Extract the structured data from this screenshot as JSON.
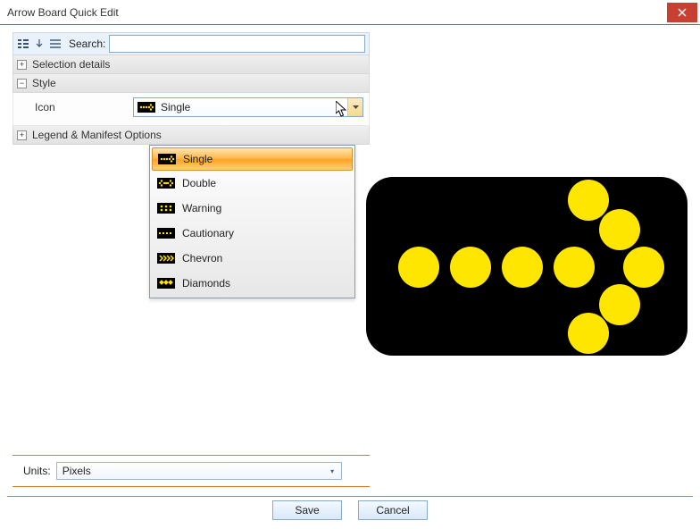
{
  "window": {
    "title": "Arrow Board Quick Edit"
  },
  "search": {
    "label": "Search:",
    "value": ""
  },
  "sections": {
    "selection_details": {
      "label": "Selection details",
      "expanded": false
    },
    "style": {
      "label": "Style",
      "expanded": true
    },
    "legend": {
      "label": "Legend & Manifest Options",
      "expanded": false
    }
  },
  "style": {
    "icon": {
      "label": "Icon",
      "value": "Single",
      "options": [
        {
          "label": "Single",
          "icon": "single"
        },
        {
          "label": "Double",
          "icon": "double"
        },
        {
          "label": "Warning",
          "icon": "warning"
        },
        {
          "label": "Cautionary",
          "icon": "cautionary"
        },
        {
          "label": "Chevron",
          "icon": "chevron"
        },
        {
          "label": "Diamonds",
          "icon": "diamonds"
        }
      ],
      "selected_index": 0
    }
  },
  "units": {
    "label": "Units:",
    "value": "Pixels"
  },
  "buttons": {
    "save": "Save",
    "cancel": "Cancel"
  },
  "toolbar_icons": {
    "categorize": "categorize-icon",
    "sort": "sort-icon",
    "list": "list-icon"
  }
}
